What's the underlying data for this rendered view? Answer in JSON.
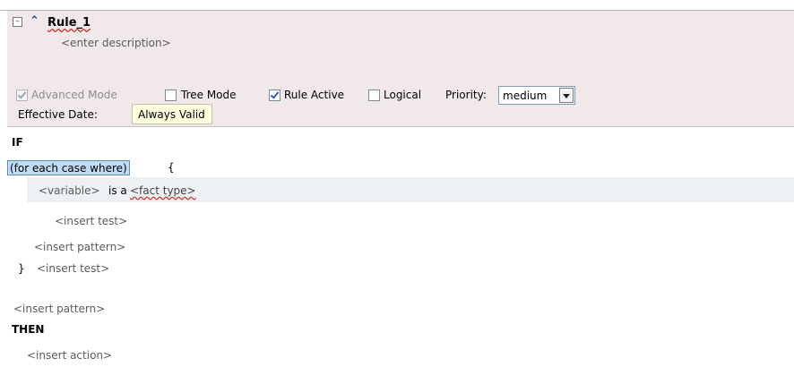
{
  "rule": {
    "name": "Rule_1",
    "description_placeholder": "<enter description>",
    "collapse_glyph": "⊟",
    "expand_glyph": "⌃"
  },
  "options": {
    "advanced_mode": {
      "label": "Advanced Mode",
      "checked": true,
      "disabled": true
    },
    "tree_mode": {
      "label": "Tree Mode",
      "checked": false
    },
    "rule_active": {
      "label": "Rule Active",
      "checked": true
    },
    "logical": {
      "label": "Logical",
      "checked": false
    },
    "priority_label": "Priority:",
    "priority_value": "medium"
  },
  "effective_date": {
    "label": "Effective Date:",
    "value": "Always Valid"
  },
  "body": {
    "if_kw": "IF",
    "for_each": "(for each case where)",
    "open_brace": "{",
    "variable": "<variable>",
    "is_a": "is a",
    "fact_type": "<fact type>",
    "insert_test_inner": "<insert test>",
    "insert_pattern_inner": "<insert pattern>",
    "close_brace": "}",
    "insert_test_outer": "<insert test>",
    "insert_pattern_outer": "<insert pattern>",
    "then_kw": "THEN",
    "insert_action": "<insert action>"
  }
}
